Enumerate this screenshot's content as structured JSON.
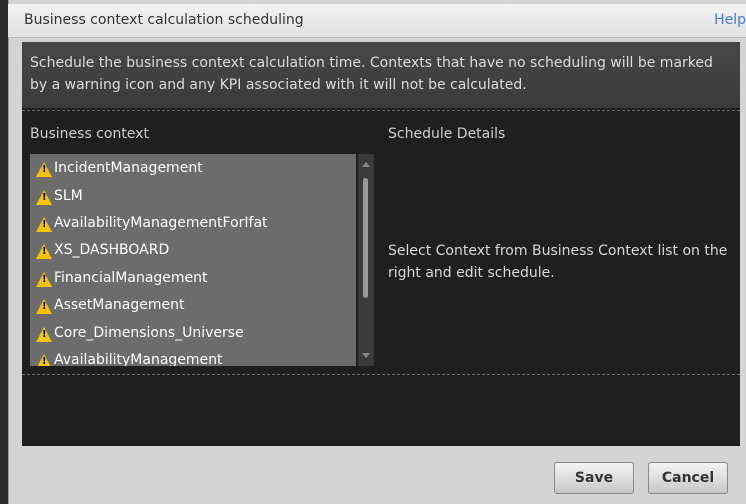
{
  "dialog": {
    "title": "Business context calculation scheduling",
    "help_label": "Help"
  },
  "description": "Schedule the business context calculation time. Contexts that have no scheduling will be marked by a warning icon and any KPI associated with it will not be calculated.",
  "columns": {
    "left_header": "Business context",
    "right_header": "Schedule Details"
  },
  "contexts": [
    {
      "label": "IncidentManagement",
      "icon": "warning-icon"
    },
    {
      "label": "SLM",
      "icon": "warning-icon"
    },
    {
      "label": "AvailabilityManagementForIfat",
      "icon": "warning-icon"
    },
    {
      "label": "XS_DASHBOARD",
      "icon": "warning-icon"
    },
    {
      "label": "FinancialManagement",
      "icon": "warning-icon"
    },
    {
      "label": "AssetManagement",
      "icon": "warning-icon"
    },
    {
      "label": "Core_Dimensions_Universe",
      "icon": "warning-icon"
    },
    {
      "label": "AvailabilityManagement",
      "icon": "warning-icon"
    }
  ],
  "details_message": "Select Context from Business Context list on the right and edit schedule.",
  "buttons": {
    "save": "Save",
    "cancel": "Cancel"
  },
  "colors": {
    "warning": "#f5c400",
    "help_link": "#3a7fd0"
  }
}
